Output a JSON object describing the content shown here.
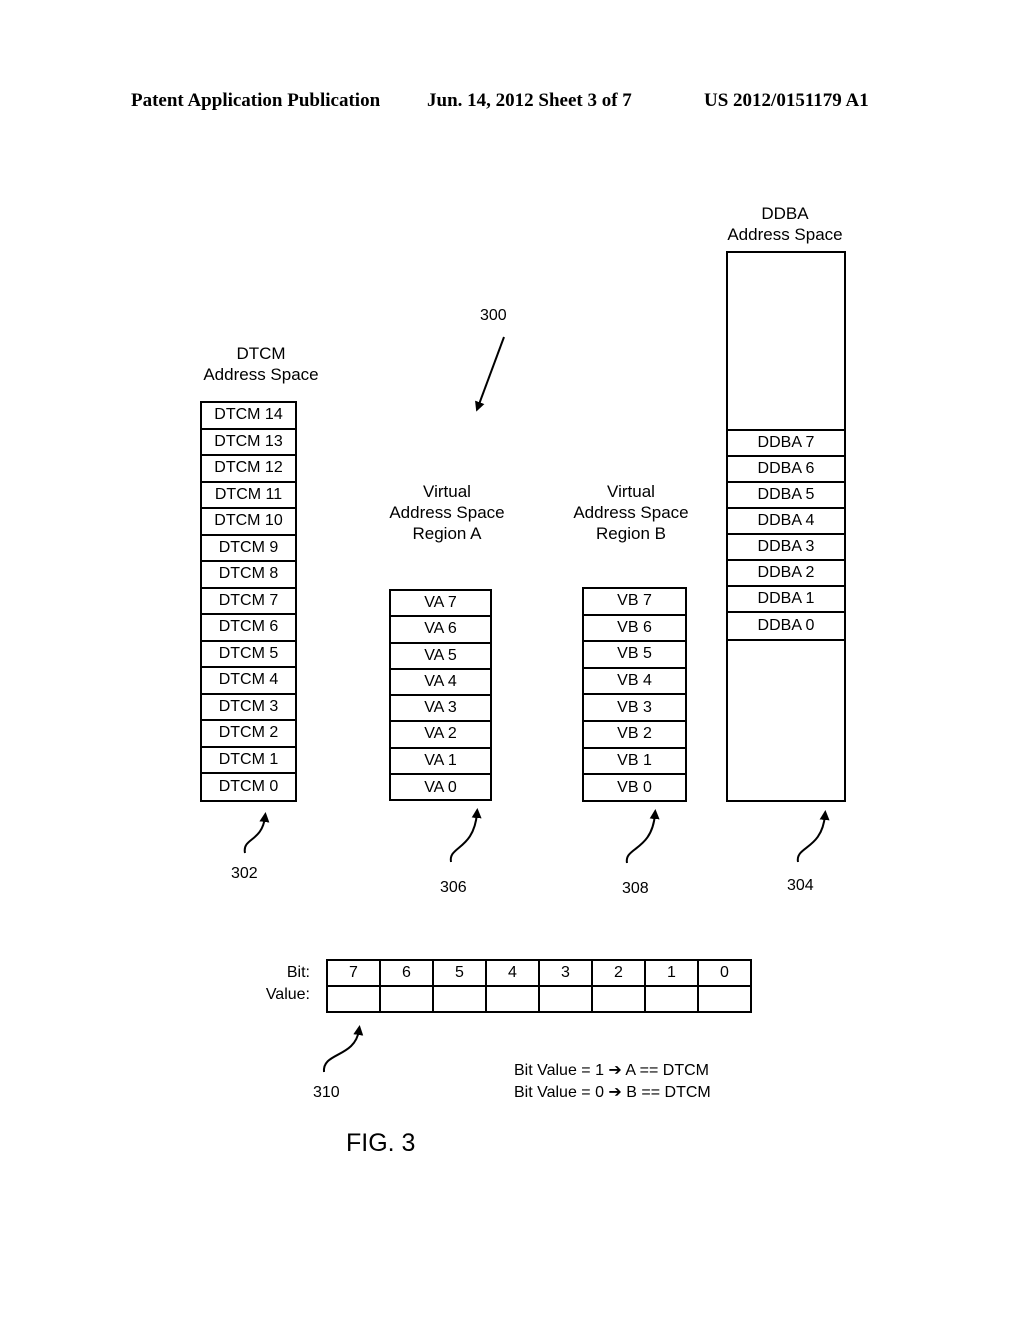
{
  "header": {
    "publication": "Patent Application Publication",
    "date_sheet": "Jun. 14, 2012  Sheet 3 of 7",
    "number": "US 2012/0151179 A1"
  },
  "figure": {
    "ref_main": "300",
    "caption": "FIG. 3"
  },
  "dtcm": {
    "title_line1": "DTCM",
    "title_line2": "Address Space",
    "ref": "302",
    "cells": [
      "DTCM 14",
      "DTCM 13",
      "DTCM 12",
      "DTCM 11",
      "DTCM 10",
      "DTCM 9",
      "DTCM 8",
      "DTCM 7",
      "DTCM 6",
      "DTCM 5",
      "DTCM 4",
      "DTCM 3",
      "DTCM 2",
      "DTCM 1",
      "DTCM 0"
    ]
  },
  "region_a": {
    "title_line1": "Virtual",
    "title_line2": "Address Space",
    "title_line3": "Region A",
    "ref": "306",
    "cells": [
      "VA 7",
      "VA 6",
      "VA 5",
      "VA 4",
      "VA 3",
      "VA 2",
      "VA 1",
      "VA 0"
    ]
  },
  "region_b": {
    "title_line1": "Virtual",
    "title_line2": "Address Space",
    "title_line3": "Region B",
    "ref": "308",
    "cells": [
      "VB 7",
      "VB 6",
      "VB 5",
      "VB 4",
      "VB 3",
      "VB 2",
      "VB 1",
      "VB 0"
    ]
  },
  "ddba": {
    "title_line1": "DDBA",
    "title_line2": "Address Space",
    "ref": "304",
    "cells": [
      "DDBA 7",
      "DDBA 6",
      "DDBA 5",
      "DDBA 4",
      "DDBA 3",
      "DDBA 2",
      "DDBA 1",
      "DDBA 0"
    ]
  },
  "bitmap": {
    "ref": "310",
    "bit_label": "Bit:",
    "value_label": "Value:",
    "bits": [
      "7",
      "6",
      "5",
      "4",
      "3",
      "2",
      "1",
      "0"
    ],
    "values": [
      "",
      "",
      "",
      "",
      "",
      "",
      "",
      ""
    ]
  },
  "legend": {
    "line1": "Bit Value = 1 ➔ A == DTCM",
    "line2": "Bit Value = 0 ➔ B == DTCM"
  }
}
